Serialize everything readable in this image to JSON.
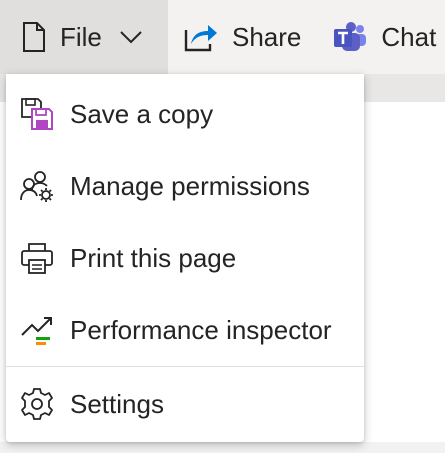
{
  "toolbar": {
    "file_label": "File",
    "share_label": "Share",
    "chat_label": "Chat"
  },
  "menu": {
    "items": [
      {
        "label": "Save a copy",
        "icon": "save-copy-icon"
      },
      {
        "label": "Manage permissions",
        "icon": "manage-permissions-icon"
      },
      {
        "label": "Print this page",
        "icon": "printer-icon"
      },
      {
        "label": "Performance inspector",
        "icon": "performance-inspector-icon"
      },
      {
        "label": "Settings",
        "icon": "gear-icon"
      }
    ]
  },
  "colors": {
    "toolbar_bg": "#f3f2f1",
    "file_active_bg": "#e1dfdd",
    "text": "#252423",
    "share_accent": "#0078d4",
    "teams_purple": "#5b5fc7",
    "save_accent": "#b146c2",
    "perf_green": "#13a10e",
    "perf_orange": "#ff8c00"
  }
}
